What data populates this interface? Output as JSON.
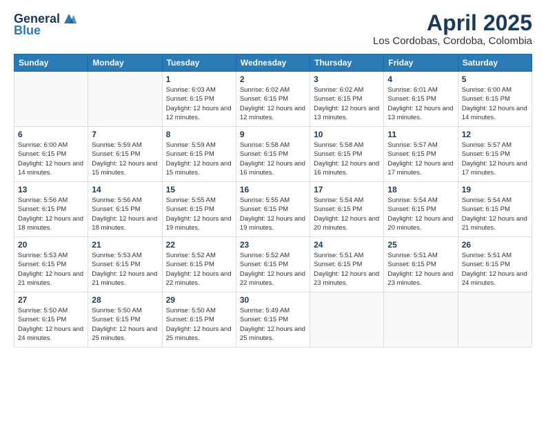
{
  "logo": {
    "general": "General",
    "blue": "Blue"
  },
  "header": {
    "title": "April 2025",
    "subtitle": "Los Cordobas, Cordoba, Colombia"
  },
  "weekdays": [
    "Sunday",
    "Monday",
    "Tuesday",
    "Wednesday",
    "Thursday",
    "Friday",
    "Saturday"
  ],
  "weeks": [
    [
      {
        "day": null
      },
      {
        "day": null
      },
      {
        "day": "1",
        "sunrise": "Sunrise: 6:03 AM",
        "sunset": "Sunset: 6:15 PM",
        "daylight": "Daylight: 12 hours and 12 minutes."
      },
      {
        "day": "2",
        "sunrise": "Sunrise: 6:02 AM",
        "sunset": "Sunset: 6:15 PM",
        "daylight": "Daylight: 12 hours and 12 minutes."
      },
      {
        "day": "3",
        "sunrise": "Sunrise: 6:02 AM",
        "sunset": "Sunset: 6:15 PM",
        "daylight": "Daylight: 12 hours and 13 minutes."
      },
      {
        "day": "4",
        "sunrise": "Sunrise: 6:01 AM",
        "sunset": "Sunset: 6:15 PM",
        "daylight": "Daylight: 12 hours and 13 minutes."
      },
      {
        "day": "5",
        "sunrise": "Sunrise: 6:00 AM",
        "sunset": "Sunset: 6:15 PM",
        "daylight": "Daylight: 12 hours and 14 minutes."
      }
    ],
    [
      {
        "day": "6",
        "sunrise": "Sunrise: 6:00 AM",
        "sunset": "Sunset: 6:15 PM",
        "daylight": "Daylight: 12 hours and 14 minutes."
      },
      {
        "day": "7",
        "sunrise": "Sunrise: 5:59 AM",
        "sunset": "Sunset: 6:15 PM",
        "daylight": "Daylight: 12 hours and 15 minutes."
      },
      {
        "day": "8",
        "sunrise": "Sunrise: 5:59 AM",
        "sunset": "Sunset: 6:15 PM",
        "daylight": "Daylight: 12 hours and 15 minutes."
      },
      {
        "day": "9",
        "sunrise": "Sunrise: 5:58 AM",
        "sunset": "Sunset: 6:15 PM",
        "daylight": "Daylight: 12 hours and 16 minutes."
      },
      {
        "day": "10",
        "sunrise": "Sunrise: 5:58 AM",
        "sunset": "Sunset: 6:15 PM",
        "daylight": "Daylight: 12 hours and 16 minutes."
      },
      {
        "day": "11",
        "sunrise": "Sunrise: 5:57 AM",
        "sunset": "Sunset: 6:15 PM",
        "daylight": "Daylight: 12 hours and 17 minutes."
      },
      {
        "day": "12",
        "sunrise": "Sunrise: 5:57 AM",
        "sunset": "Sunset: 6:15 PM",
        "daylight": "Daylight: 12 hours and 17 minutes."
      }
    ],
    [
      {
        "day": "13",
        "sunrise": "Sunrise: 5:56 AM",
        "sunset": "Sunset: 6:15 PM",
        "daylight": "Daylight: 12 hours and 18 minutes."
      },
      {
        "day": "14",
        "sunrise": "Sunrise: 5:56 AM",
        "sunset": "Sunset: 6:15 PM",
        "daylight": "Daylight: 12 hours and 18 minutes."
      },
      {
        "day": "15",
        "sunrise": "Sunrise: 5:55 AM",
        "sunset": "Sunset: 6:15 PM",
        "daylight": "Daylight: 12 hours and 19 minutes."
      },
      {
        "day": "16",
        "sunrise": "Sunrise: 5:55 AM",
        "sunset": "Sunset: 6:15 PM",
        "daylight": "Daylight: 12 hours and 19 minutes."
      },
      {
        "day": "17",
        "sunrise": "Sunrise: 5:54 AM",
        "sunset": "Sunset: 6:15 PM",
        "daylight": "Daylight: 12 hours and 20 minutes."
      },
      {
        "day": "18",
        "sunrise": "Sunrise: 5:54 AM",
        "sunset": "Sunset: 6:15 PM",
        "daylight": "Daylight: 12 hours and 20 minutes."
      },
      {
        "day": "19",
        "sunrise": "Sunrise: 5:54 AM",
        "sunset": "Sunset: 6:15 PM",
        "daylight": "Daylight: 12 hours and 21 minutes."
      }
    ],
    [
      {
        "day": "20",
        "sunrise": "Sunrise: 5:53 AM",
        "sunset": "Sunset: 6:15 PM",
        "daylight": "Daylight: 12 hours and 21 minutes."
      },
      {
        "day": "21",
        "sunrise": "Sunrise: 5:53 AM",
        "sunset": "Sunset: 6:15 PM",
        "daylight": "Daylight: 12 hours and 21 minutes."
      },
      {
        "day": "22",
        "sunrise": "Sunrise: 5:52 AM",
        "sunset": "Sunset: 6:15 PM",
        "daylight": "Daylight: 12 hours and 22 minutes."
      },
      {
        "day": "23",
        "sunrise": "Sunrise: 5:52 AM",
        "sunset": "Sunset: 6:15 PM",
        "daylight": "Daylight: 12 hours and 22 minutes."
      },
      {
        "day": "24",
        "sunrise": "Sunrise: 5:51 AM",
        "sunset": "Sunset: 6:15 PM",
        "daylight": "Daylight: 12 hours and 23 minutes."
      },
      {
        "day": "25",
        "sunrise": "Sunrise: 5:51 AM",
        "sunset": "Sunset: 6:15 PM",
        "daylight": "Daylight: 12 hours and 23 minutes."
      },
      {
        "day": "26",
        "sunrise": "Sunrise: 5:51 AM",
        "sunset": "Sunset: 6:15 PM",
        "daylight": "Daylight: 12 hours and 24 minutes."
      }
    ],
    [
      {
        "day": "27",
        "sunrise": "Sunrise: 5:50 AM",
        "sunset": "Sunset: 6:15 PM",
        "daylight": "Daylight: 12 hours and 24 minutes."
      },
      {
        "day": "28",
        "sunrise": "Sunrise: 5:50 AM",
        "sunset": "Sunset: 6:15 PM",
        "daylight": "Daylight: 12 hours and 25 minutes."
      },
      {
        "day": "29",
        "sunrise": "Sunrise: 5:50 AM",
        "sunset": "Sunset: 6:15 PM",
        "daylight": "Daylight: 12 hours and 25 minutes."
      },
      {
        "day": "30",
        "sunrise": "Sunrise: 5:49 AM",
        "sunset": "Sunset: 6:15 PM",
        "daylight": "Daylight: 12 hours and 25 minutes."
      },
      {
        "day": null
      },
      {
        "day": null
      },
      {
        "day": null
      }
    ]
  ]
}
